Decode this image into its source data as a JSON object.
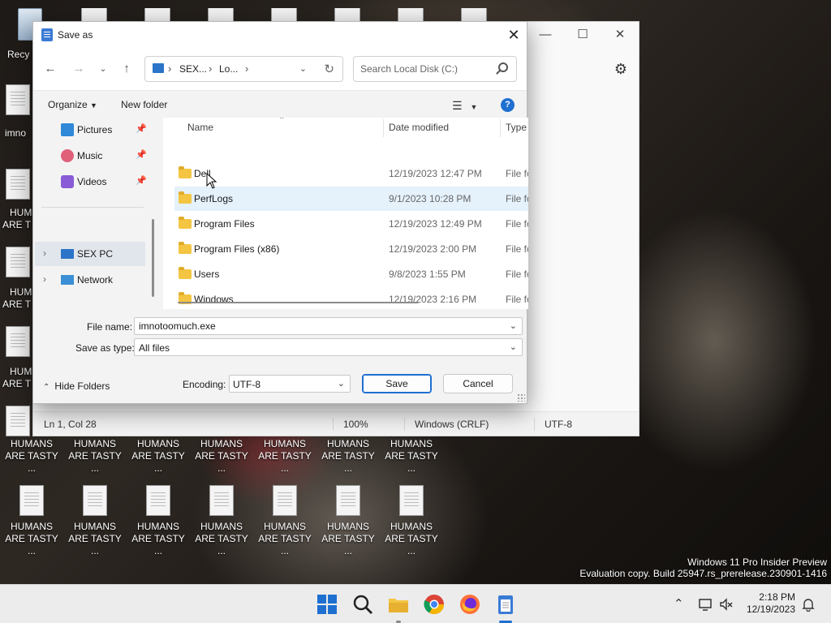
{
  "desktop": {
    "recycle_label": "Recy",
    "partial_labels": [
      "imno",
      "HUM",
      "ARE T",
      "HUM",
      "ARE T",
      "HUM",
      "ARE T"
    ],
    "icon_line1": "HUMANS",
    "icon_line2": "ARE TASTY ..."
  },
  "notepad": {
    "status_position": "Ln 1, Col 28",
    "status_zoom": "100%",
    "status_line_ending": "Windows (CRLF)",
    "status_encoding": "UTF-8"
  },
  "dialog": {
    "title": "Save as",
    "address": {
      "seg1": "SEX...",
      "seg2": "Lo..."
    },
    "search_placeholder": "Search Local Disk (C:)",
    "toolbar": {
      "organize": "Organize",
      "new_folder": "New folder"
    },
    "nav": {
      "quick": [
        {
          "label": "Pictures",
          "icon": "pictures-icon"
        },
        {
          "label": "Music",
          "icon": "music-icon"
        },
        {
          "label": "Videos",
          "icon": "videos-icon"
        }
      ],
      "sex_pc": "SEX PC",
      "network": "Network"
    },
    "columns": {
      "name": "Name",
      "date": "Date modified",
      "type": "Type"
    },
    "files": [
      {
        "name": "Dell",
        "date": "12/19/2023 12:47 PM",
        "type": "File fo"
      },
      {
        "name": "PerfLogs",
        "date": "9/1/2023 10:28 PM",
        "type": "File fo"
      },
      {
        "name": "Program Files",
        "date": "12/19/2023 12:49 PM",
        "type": "File fo"
      },
      {
        "name": "Program Files (x86)",
        "date": "12/19/2023 2:00 PM",
        "type": "File fo"
      },
      {
        "name": "Users",
        "date": "9/8/2023 1:55 PM",
        "type": "File fo"
      },
      {
        "name": "Windows",
        "date": "12/19/2023 2:16 PM",
        "type": "File fo"
      }
    ],
    "file_name_label": "File name:",
    "file_name_value": "imnotoomuch.exe",
    "save_type_label": "Save as type:",
    "save_type_value": "All files",
    "hide_folders": "Hide Folders",
    "encoding_label": "Encoding:",
    "encoding_value": "UTF-8",
    "save_button": "Save",
    "cancel_button": "Cancel"
  },
  "watermark": {
    "line1": "Windows 11 Pro Insider Preview",
    "line2": "Evaluation copy. Build 25947.rs_prerelease.230901-1416"
  },
  "clock": {
    "time": "2:18 PM",
    "date": "12/19/2023"
  },
  "colors": {
    "accent": "#1f6fd1",
    "folder": "#f4c542",
    "hover_row": "#e5f1fb"
  }
}
